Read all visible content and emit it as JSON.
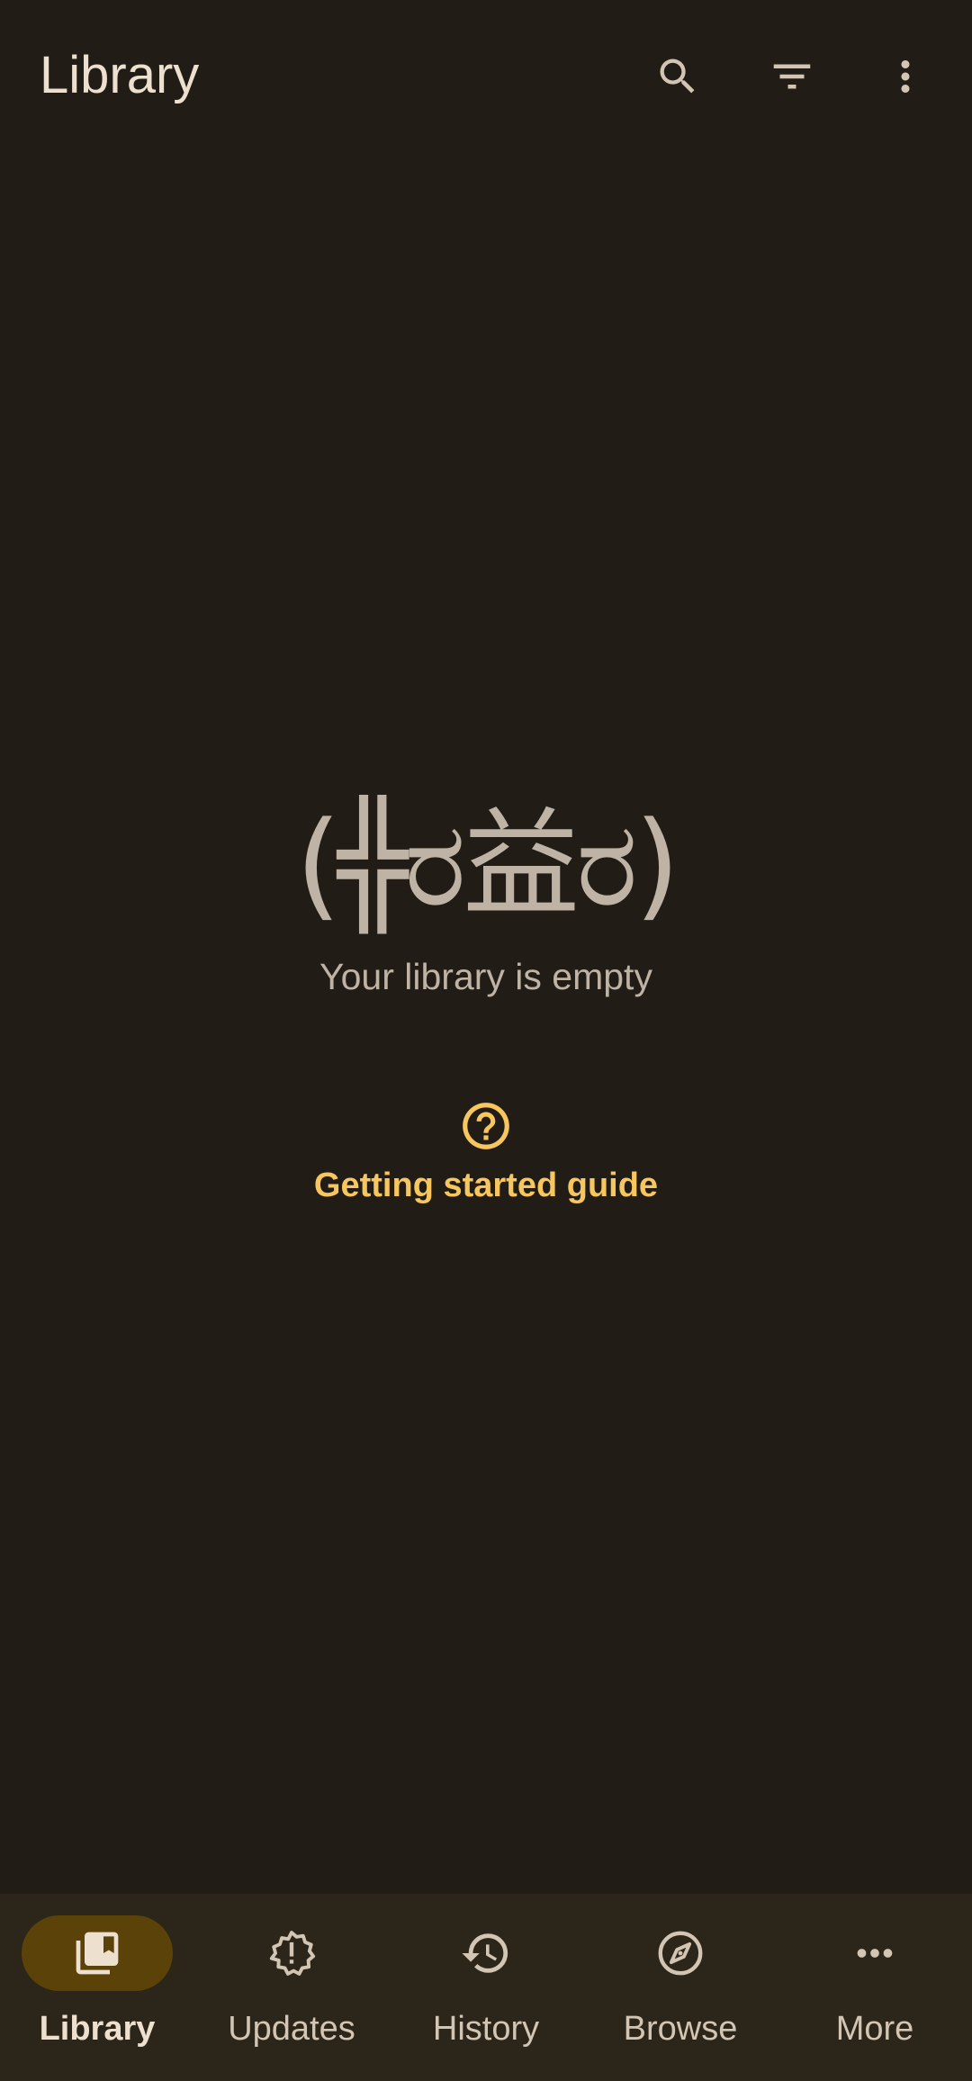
{
  "topbar": {
    "title": "Library",
    "actions": [
      {
        "icon": "search-icon"
      },
      {
        "icon": "filter-icon"
      },
      {
        "icon": "more-vert-icon"
      }
    ]
  },
  "empty_state": {
    "kaomoji": "(╬ರ益ರ)",
    "message": "Your library is empty",
    "guide_icon": "help-circle-icon",
    "guide_label": "Getting started guide"
  },
  "bottom_nav": {
    "items": [
      {
        "label": "Library",
        "icon": "library-bookmark-icon",
        "active": true
      },
      {
        "label": "Updates",
        "icon": "new-releases-icon",
        "active": false
      },
      {
        "label": "History",
        "icon": "history-icon",
        "active": false
      },
      {
        "label": "Browse",
        "icon": "compass-icon",
        "active": false
      },
      {
        "label": "More",
        "icon": "more-horiz-icon",
        "active": false
      }
    ]
  },
  "colors": {
    "background": "#211d16",
    "nav_background": "#2c2519",
    "accent": "#f7c65e",
    "active_pill": "#5b4209",
    "text_primary": "#ede0cf",
    "text_secondary": "#beb3a5"
  }
}
